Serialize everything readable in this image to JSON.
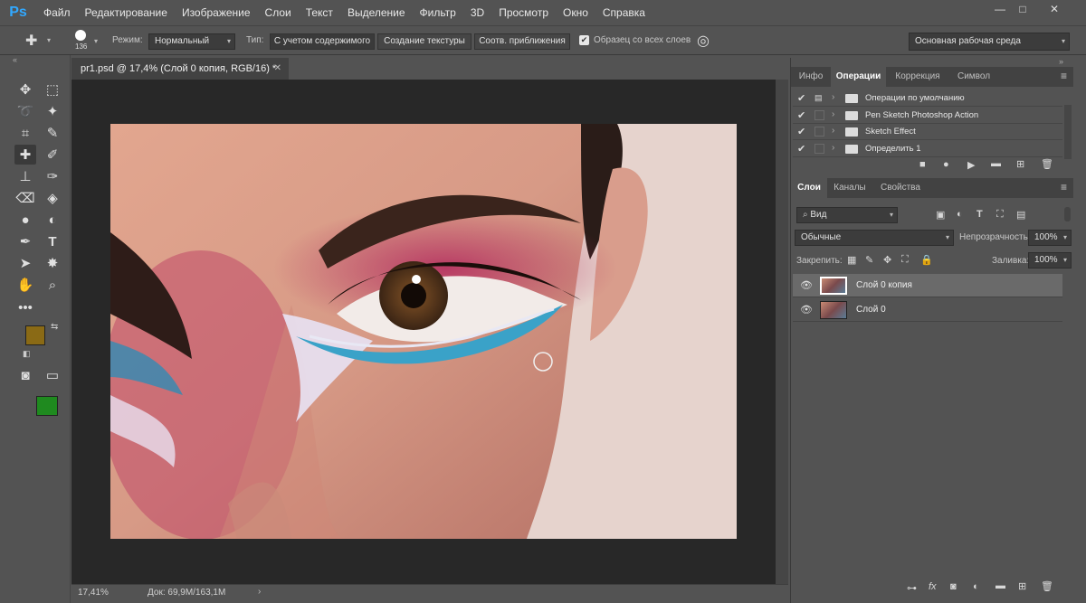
{
  "app": {
    "logo": "Ps",
    "accent": "#31a8ff"
  },
  "menu": [
    "Файл",
    "Редактирование",
    "Изображение",
    "Слои",
    "Текст",
    "Выделение",
    "Фильтр",
    "3D",
    "Просмотр",
    "Окно",
    "Справка"
  ],
  "window_controls": {
    "minimize": "—",
    "maximize": "□",
    "close": "✕"
  },
  "options_bar": {
    "brush_size": "136",
    "mode_label": "Режим:",
    "mode_value": "Нормальный",
    "type_label": "Тип:",
    "type_buttons": [
      "С учетом содержимого",
      "Создание текстуры",
      "Соотв. приближения"
    ],
    "sample_all_label": "Образец со всех слоев",
    "workspace": "Основная рабочая среда"
  },
  "document": {
    "tab_title": "pr1.psd @ 17,4% (Слой 0 копия, RGB/16) *",
    "zoom": "17,41%",
    "doc_info": "Док: 69,9M/163,1M"
  },
  "colors": {
    "foreground": "#8a6a15",
    "background": "#1f8a1f"
  },
  "actions_panel": {
    "tabs": [
      "Инфо",
      "Операции",
      "Коррекция",
      "Символ"
    ],
    "active_tab": "Операции",
    "items": [
      {
        "label": "Операции по умолчанию"
      },
      {
        "label": "Pen Sketch Photoshop Action"
      },
      {
        "label": "Sketch Effect"
      },
      {
        "label": "Определить 1"
      }
    ]
  },
  "layers_panel": {
    "tabs": [
      "Слои",
      "Каналы",
      "Свойства"
    ],
    "active_tab": "Слои",
    "filter_kind": "Вид",
    "blend_mode": "Обычные",
    "opacity_label": "Непрозрачность:",
    "opacity_value": "100%",
    "lock_label": "Закрепить:",
    "fill_label": "Заливка:",
    "fill_value": "100%",
    "layers": [
      {
        "name": "Слой 0 копия",
        "selected": true
      },
      {
        "name": "Слой 0",
        "selected": false
      }
    ]
  }
}
